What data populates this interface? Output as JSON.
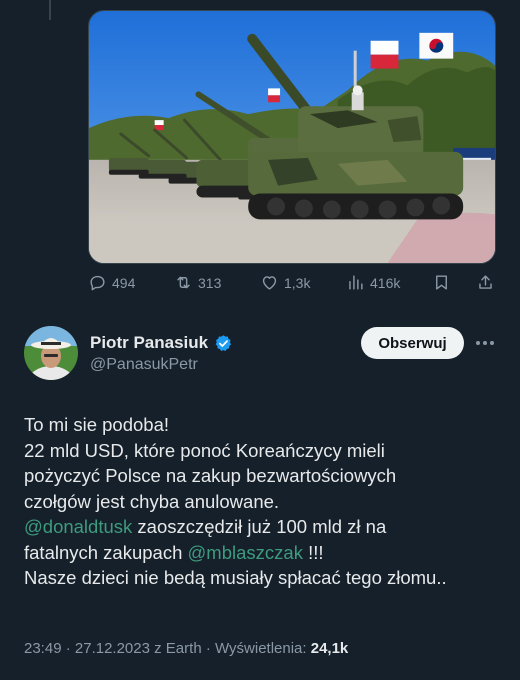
{
  "previous_tweet": {
    "image": {
      "subject": "tank-parade-photo"
    },
    "actions": {
      "replies": "494",
      "retweets": "313",
      "likes": "1,3k",
      "views": "416k"
    }
  },
  "tweet": {
    "author": {
      "name": "Piotr Panasiuk",
      "handle": "@PanasukPetr",
      "verified": true
    },
    "follow_label": "Obserwuj",
    "text": {
      "line1": "To mi sie podoba!",
      "line2": "22 mld USD, które ponoć Koreańczycy mieli",
      "line3": "pożyczyć Polsce na zakup bezwartościowych",
      "line4": "czołgów jest chyba anulowane.",
      "mention1": "@donaldtusk",
      "line5_rest": " zaoszczędził już 100 mld zł na",
      "line6_pre": "fatalnych zakupach ",
      "mention2": "@mblaszczak",
      "line6_post": " !!!",
      "line7": "Nasze dzieci nie bedą musiały spłacać tego złomu.."
    },
    "meta": {
      "time": "23:49",
      "sep1": " · ",
      "date": "27.12.2023",
      "source": " z Earth",
      "sep2": " · ",
      "views_label": "Wyświetlenia: ",
      "views_value": "24,1k"
    }
  },
  "colors": {
    "background": "#15202b",
    "text": "#e7e9ea",
    "muted": "#8b98a5",
    "mention": "#3e9b7d",
    "verified": "#1d9bf0"
  }
}
